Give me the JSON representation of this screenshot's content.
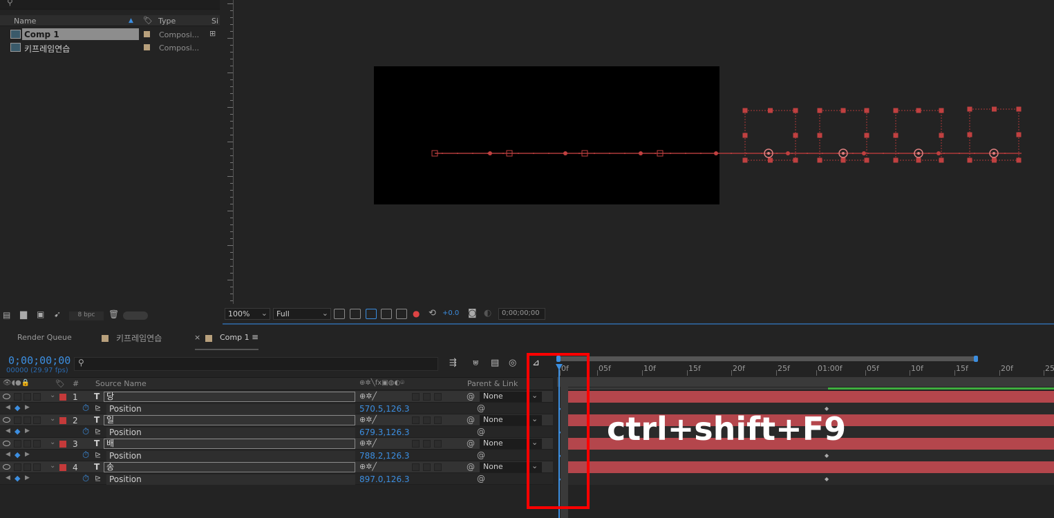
{
  "project": {
    "columns": {
      "name": "Name",
      "type": "Type",
      "size": "Si"
    },
    "items": [
      {
        "name": "Comp 1",
        "type": "Composi..."
      },
      {
        "name": "키프레임연습",
        "type": "Composi..."
      }
    ],
    "bpc": "8 bpc"
  },
  "viewer": {
    "zoom": "100%",
    "resolution": "Full",
    "exposure": "+0.0",
    "timecode": "0;00;00;00"
  },
  "tabs": {
    "render_queue": "Render Queue",
    "comp_a": "키프레임연습",
    "comp_b": "Comp 1"
  },
  "timeline": {
    "current_time": "0;00;00;00",
    "fps": "00000 (29.97 fps)",
    "header": {
      "num": "#",
      "source_name": "Source Name",
      "parent_link": "Parent & Link"
    },
    "ruler": [
      "0f",
      "05f",
      "10f",
      "15f",
      "20f",
      "25f",
      "01:00f",
      "05f",
      "10f",
      "15f",
      "20f",
      "25"
    ],
    "layers": [
      {
        "num": "1",
        "name": "당",
        "prop": "Position",
        "value": "570.5,126.3",
        "parent": "None"
      },
      {
        "num": "2",
        "name": "일",
        "prop": "Position",
        "value": "679.3,126.3",
        "parent": "None"
      },
      {
        "num": "3",
        "name": "배",
        "prop": "Position",
        "value": "788.2,126.3",
        "parent": "None"
      },
      {
        "num": "4",
        "name": "송",
        "prop": "Position",
        "value": "897.0,126.3",
        "parent": "None"
      }
    ]
  },
  "overlay_text": "ctrl+shift+F9"
}
